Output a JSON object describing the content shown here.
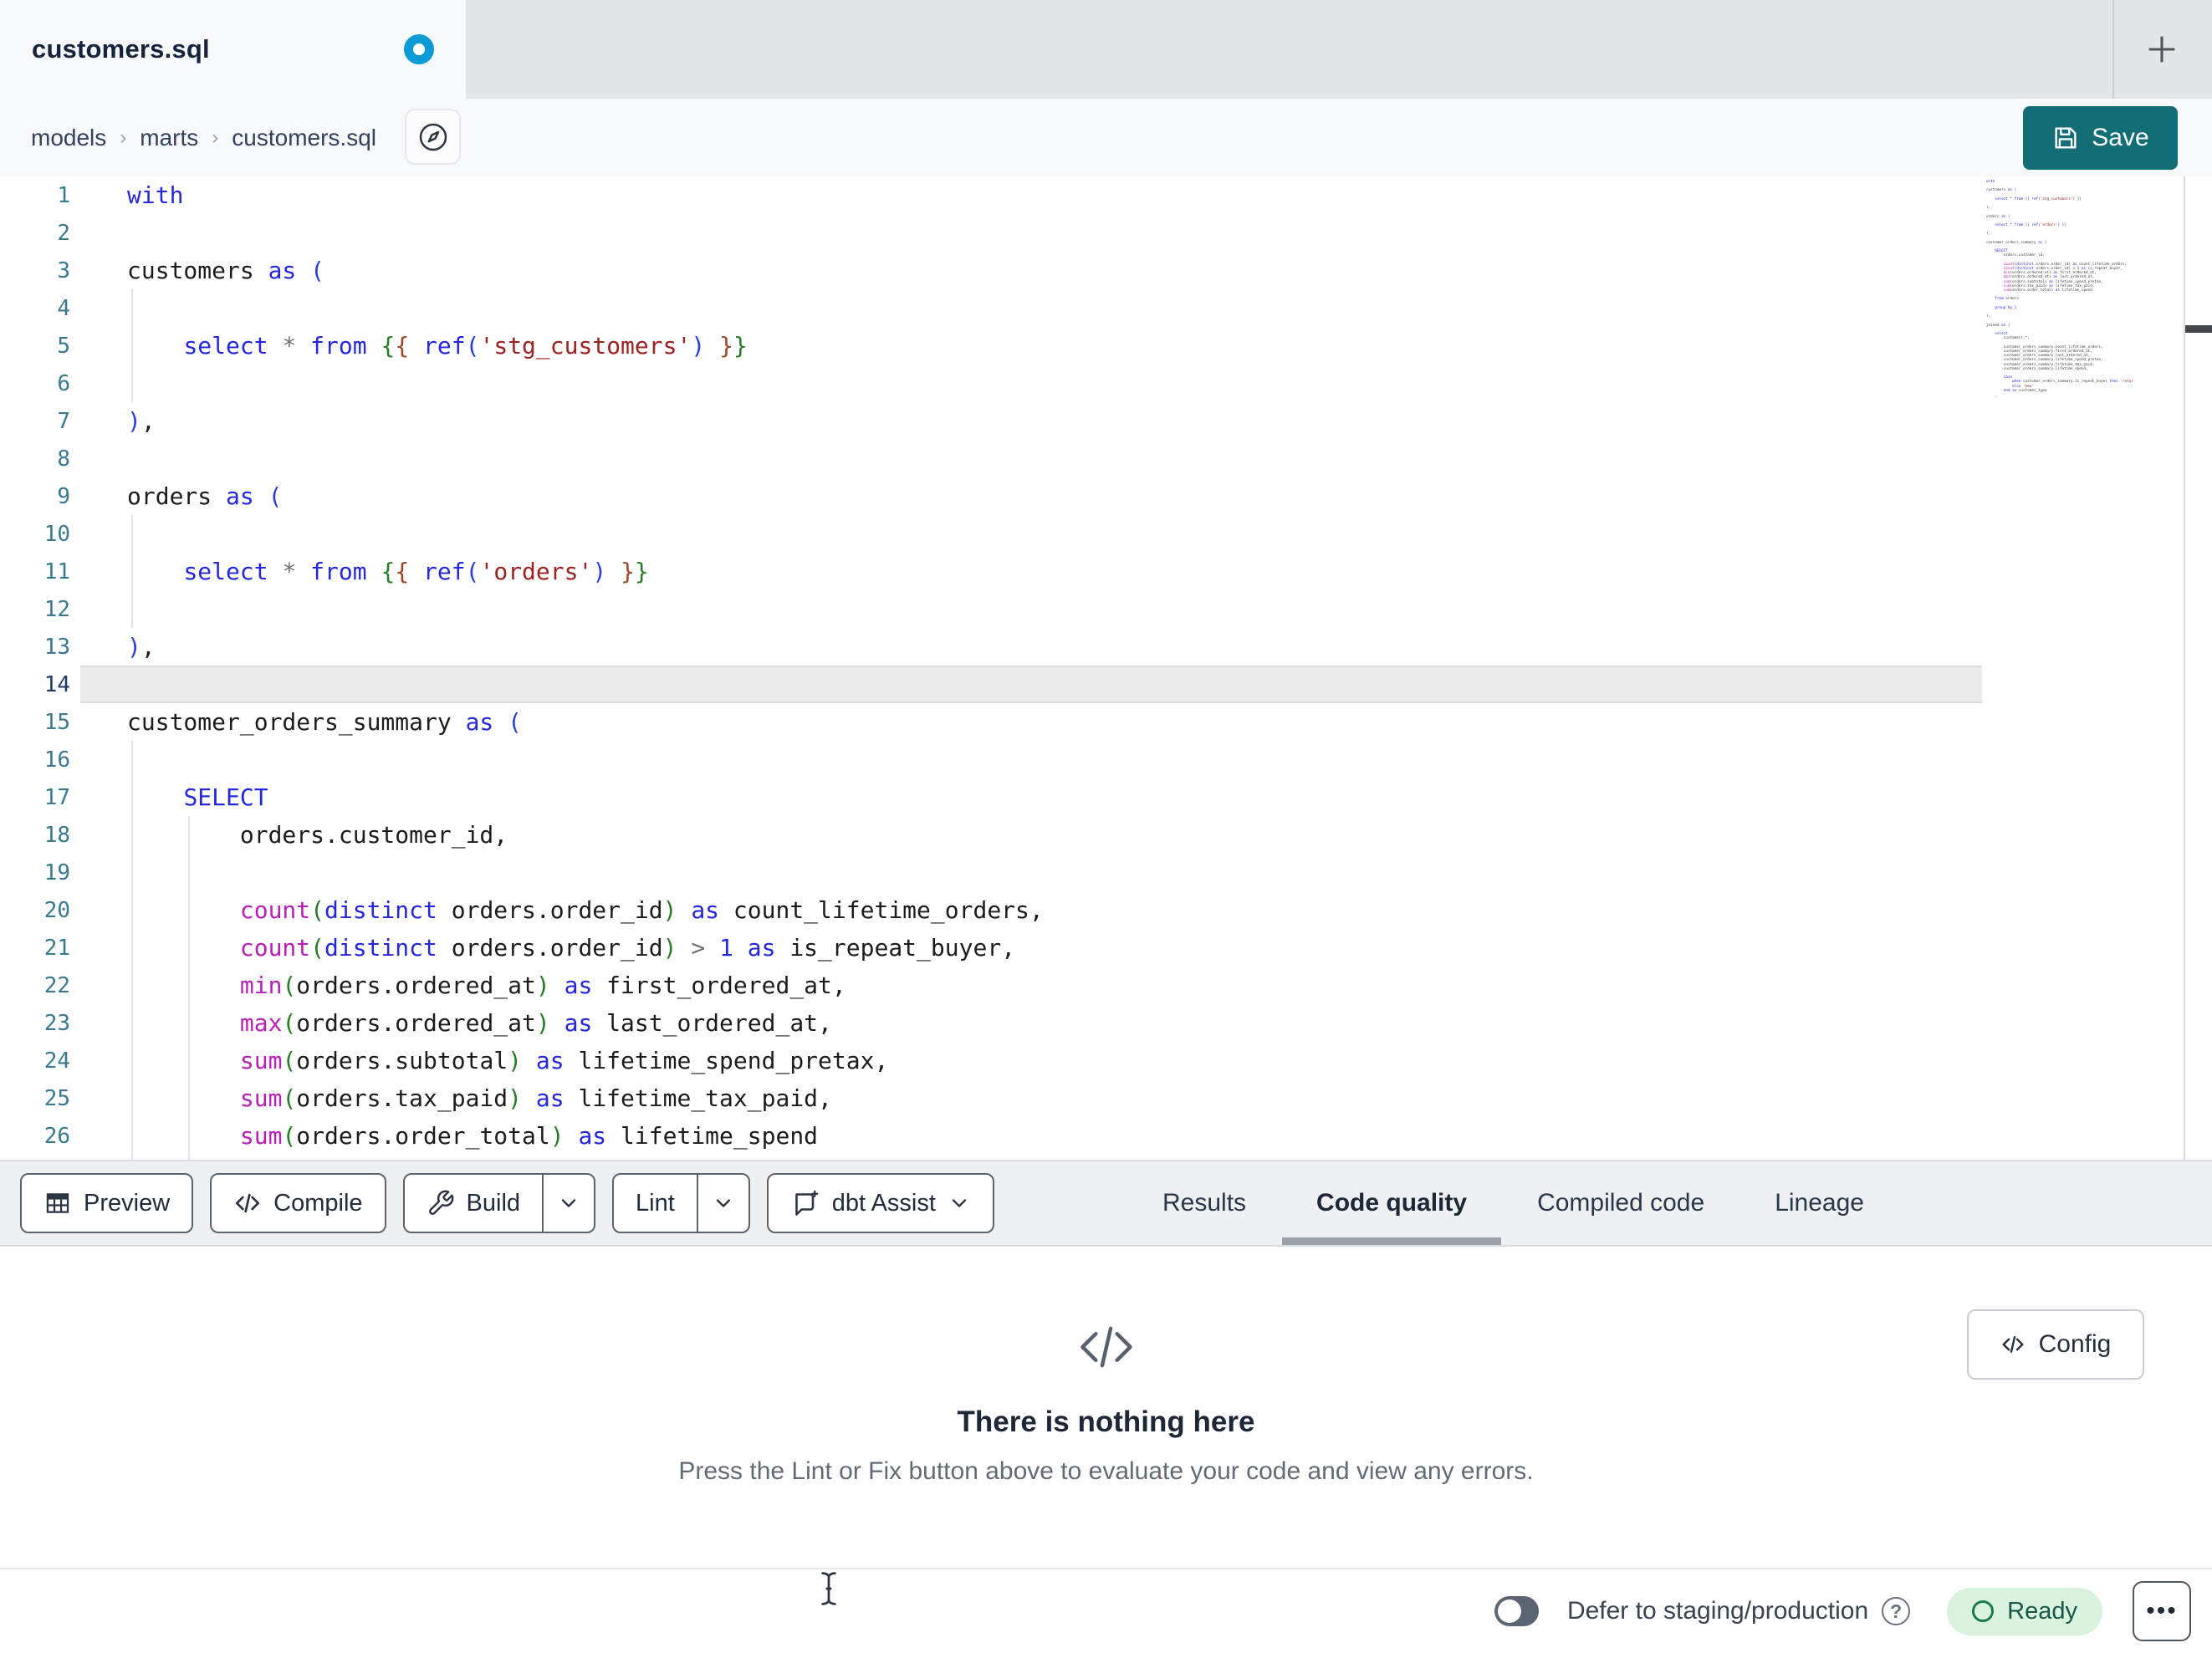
{
  "window": {
    "tab_title": "customers.sql",
    "unsaved_indicator": "unsaved-changes-dot",
    "new_tab_glyph": "+"
  },
  "breadcrumb": {
    "items": [
      "models",
      "marts",
      "customers.sql"
    ],
    "separator": "›"
  },
  "actions": {
    "save_label": "Save"
  },
  "editor": {
    "current_line": 14,
    "lines": [
      {
        "n": 1,
        "tokens": [
          {
            "t": "with",
            "c": "kw"
          }
        ]
      },
      {
        "n": 2,
        "tokens": []
      },
      {
        "n": 3,
        "tokens": [
          {
            "t": "customers ",
            "c": "pl"
          },
          {
            "t": "as",
            "c": "kw"
          },
          {
            "t": " ",
            "c": "pl"
          },
          {
            "t": "(",
            "c": "b3"
          }
        ]
      },
      {
        "n": 4,
        "tokens": []
      },
      {
        "n": 5,
        "tokens": [
          {
            "t": "    ",
            "c": "pl"
          },
          {
            "t": "select",
            "c": "kw"
          },
          {
            "t": " ",
            "c": "pl"
          },
          {
            "t": "*",
            "c": "op"
          },
          {
            "t": " ",
            "c": "pl"
          },
          {
            "t": "from",
            "c": "kw"
          },
          {
            "t": " ",
            "c": "pl"
          },
          {
            "t": "{",
            "c": "b1"
          },
          {
            "t": "{",
            "c": "b2"
          },
          {
            "t": " ",
            "c": "pl"
          },
          {
            "t": "ref",
            "c": "kw"
          },
          {
            "t": "(",
            "c": "b3"
          },
          {
            "t": "'stg_customers'",
            "c": "str"
          },
          {
            "t": ")",
            "c": "b3"
          },
          {
            "t": " ",
            "c": "pl"
          },
          {
            "t": "}",
            "c": "b2"
          },
          {
            "t": "}",
            "c": "b1"
          }
        ]
      },
      {
        "n": 6,
        "tokens": []
      },
      {
        "n": 7,
        "tokens": [
          {
            "t": ")",
            "c": "b3"
          },
          {
            "t": ",",
            "c": "pl"
          }
        ]
      },
      {
        "n": 8,
        "tokens": []
      },
      {
        "n": 9,
        "tokens": [
          {
            "t": "orders ",
            "c": "pl"
          },
          {
            "t": "as",
            "c": "kw"
          },
          {
            "t": " ",
            "c": "pl"
          },
          {
            "t": "(",
            "c": "b3"
          }
        ]
      },
      {
        "n": 10,
        "tokens": []
      },
      {
        "n": 11,
        "tokens": [
          {
            "t": "    ",
            "c": "pl"
          },
          {
            "t": "select",
            "c": "kw"
          },
          {
            "t": " ",
            "c": "pl"
          },
          {
            "t": "*",
            "c": "op"
          },
          {
            "t": " ",
            "c": "pl"
          },
          {
            "t": "from",
            "c": "kw"
          },
          {
            "t": " ",
            "c": "pl"
          },
          {
            "t": "{",
            "c": "b1"
          },
          {
            "t": "{",
            "c": "b2"
          },
          {
            "t": " ",
            "c": "pl"
          },
          {
            "t": "ref",
            "c": "kw"
          },
          {
            "t": "(",
            "c": "b3"
          },
          {
            "t": "'orders'",
            "c": "str"
          },
          {
            "t": ")",
            "c": "b3"
          },
          {
            "t": " ",
            "c": "pl"
          },
          {
            "t": "}",
            "c": "b2"
          },
          {
            "t": "}",
            "c": "b1"
          }
        ]
      },
      {
        "n": 12,
        "tokens": []
      },
      {
        "n": 13,
        "tokens": [
          {
            "t": ")",
            "c": "b3"
          },
          {
            "t": ",",
            "c": "pl"
          }
        ]
      },
      {
        "n": 14,
        "tokens": [],
        "current": true
      },
      {
        "n": 15,
        "tokens": [
          {
            "t": "customer_orders_summary ",
            "c": "pl"
          },
          {
            "t": "as",
            "c": "kw"
          },
          {
            "t": " ",
            "c": "pl"
          },
          {
            "t": "(",
            "c": "b3"
          }
        ]
      },
      {
        "n": 16,
        "tokens": []
      },
      {
        "n": 17,
        "tokens": [
          {
            "t": "    ",
            "c": "pl"
          },
          {
            "t": "SELECT",
            "c": "kw"
          }
        ]
      },
      {
        "n": 18,
        "tokens": [
          {
            "t": "        orders.customer_id,",
            "c": "pl"
          }
        ]
      },
      {
        "n": 19,
        "tokens": []
      },
      {
        "n": 20,
        "tokens": [
          {
            "t": "        ",
            "c": "pl"
          },
          {
            "t": "count",
            "c": "fn"
          },
          {
            "t": "(",
            "c": "b1"
          },
          {
            "t": "distinct",
            "c": "kw"
          },
          {
            "t": " orders.order_id",
            "c": "pl"
          },
          {
            "t": ")",
            "c": "b1"
          },
          {
            "t": " ",
            "c": "pl"
          },
          {
            "t": "as",
            "c": "kw"
          },
          {
            "t": " count_lifetime_orders,",
            "c": "pl"
          }
        ]
      },
      {
        "n": 21,
        "tokens": [
          {
            "t": "        ",
            "c": "pl"
          },
          {
            "t": "count",
            "c": "fn"
          },
          {
            "t": "(",
            "c": "b1"
          },
          {
            "t": "distinct",
            "c": "kw"
          },
          {
            "t": " orders.order_id",
            "c": "pl"
          },
          {
            "t": ")",
            "c": "b1"
          },
          {
            "t": " ",
            "c": "pl"
          },
          {
            "t": ">",
            "c": "op"
          },
          {
            "t": " ",
            "c": "pl"
          },
          {
            "t": "1",
            "c": "num"
          },
          {
            "t": " ",
            "c": "pl"
          },
          {
            "t": "as",
            "c": "kw"
          },
          {
            "t": " is_repeat_buyer,",
            "c": "pl"
          }
        ]
      },
      {
        "n": 22,
        "tokens": [
          {
            "t": "        ",
            "c": "pl"
          },
          {
            "t": "min",
            "c": "fn"
          },
          {
            "t": "(",
            "c": "b1"
          },
          {
            "t": "orders.ordered_at",
            "c": "pl"
          },
          {
            "t": ")",
            "c": "b1"
          },
          {
            "t": " ",
            "c": "pl"
          },
          {
            "t": "as",
            "c": "kw"
          },
          {
            "t": " first_ordered_at,",
            "c": "pl"
          }
        ]
      },
      {
        "n": 23,
        "tokens": [
          {
            "t": "        ",
            "c": "pl"
          },
          {
            "t": "max",
            "c": "fn"
          },
          {
            "t": "(",
            "c": "b1"
          },
          {
            "t": "orders.ordered_at",
            "c": "pl"
          },
          {
            "t": ")",
            "c": "b1"
          },
          {
            "t": " ",
            "c": "pl"
          },
          {
            "t": "as",
            "c": "kw"
          },
          {
            "t": " last_ordered_at,",
            "c": "pl"
          }
        ]
      },
      {
        "n": 24,
        "tokens": [
          {
            "t": "        ",
            "c": "pl"
          },
          {
            "t": "sum",
            "c": "fn"
          },
          {
            "t": "(",
            "c": "b1"
          },
          {
            "t": "orders.subtotal",
            "c": "pl"
          },
          {
            "t": ")",
            "c": "b1"
          },
          {
            "t": " ",
            "c": "pl"
          },
          {
            "t": "as",
            "c": "kw"
          },
          {
            "t": " lifetime_spend_pretax,",
            "c": "pl"
          }
        ]
      },
      {
        "n": 25,
        "tokens": [
          {
            "t": "        ",
            "c": "pl"
          },
          {
            "t": "sum",
            "c": "fn"
          },
          {
            "t": "(",
            "c": "b1"
          },
          {
            "t": "orders.tax_paid",
            "c": "pl"
          },
          {
            "t": ")",
            "c": "b1"
          },
          {
            "t": " ",
            "c": "pl"
          },
          {
            "t": "as",
            "c": "kw"
          },
          {
            "t": " lifetime_tax_paid,",
            "c": "pl"
          }
        ]
      },
      {
        "n": 26,
        "tokens": [
          {
            "t": "        ",
            "c": "pl"
          },
          {
            "t": "sum",
            "c": "fn"
          },
          {
            "t": "(",
            "c": "b1"
          },
          {
            "t": "orders.order_total",
            "c": "pl"
          },
          {
            "t": ")",
            "c": "b1"
          },
          {
            "t": " ",
            "c": "pl"
          },
          {
            "t": "as",
            "c": "kw"
          },
          {
            "t": " lifetime_spend",
            "c": "pl"
          }
        ]
      }
    ],
    "minimap_code": "with\n\ncustomers as (\n\n    select * from {{ ref('stg_customers') }}\n\n),\n\norders as (\n\n    select * from {{ ref('orders') }}\n\n),\n\ncustomer_orders_summary as (\n\n    SELECT\n        orders.customer_id,\n\n        count(distinct orders.order_id) as count_lifetime_orders,\n        count(distinct orders.order_id) > 1 as is_repeat_buyer,\n        min(orders.ordered_at) as first_ordered_at,\n        max(orders.ordered_at) as last_ordered_at,\n        sum(orders.subtotal) as lifetime_spend_pretax,\n        sum(orders.tax_paid) as lifetime_tax_paid,\n        sum(orders.order_total) as lifetime_spend\n\n    from orders\n\n    group by 1\n\n),\n\njoined as (\n\n    select\n        customers.*,\n\n        customer_orders_summary.count_lifetime_orders,\n        customer_orders_summary.first_ordered_at,\n        customer_orders_summary.last_ordered_at,\n        customer_orders_summary.lifetime_spend_pretax,\n        customer_orders_summary.lifetime_tax_paid,\n        customer_orders_summary.lifetime_spend,\n\n        case\n            when customer_orders_summary.is_repeat_buyer then 'returning'\n            else 'new'\n        end as customer_type\n\n    from customers\n\n    left join customer_orders_summary\n        on customers.customer_id = customer_orders_summary.customer_id\n\n)\n\nselect * from joined"
  },
  "toolbar": {
    "preview_label": "Preview",
    "compile_label": "Compile",
    "build_label": "Build",
    "lint_label": "Lint",
    "dbt_assist_label": "dbt Assist"
  },
  "result_tabs": [
    {
      "label": "Results",
      "active": false
    },
    {
      "label": "Code quality",
      "active": true
    },
    {
      "label": "Compiled code",
      "active": false
    },
    {
      "label": "Lineage",
      "active": false
    }
  ],
  "panel": {
    "empty_title": "There is nothing here",
    "empty_subtitle": "Press the Lint or Fix button above to evaluate your code and view any errors.",
    "config_label": "Config"
  },
  "statusbar": {
    "defer_label": "Defer to staging/production",
    "help_glyph": "?",
    "ready_label": "Ready",
    "more_glyph": "•••"
  },
  "colors": {
    "accent_teal": "#136d74",
    "unsaved_dot_blue": "#0d9bd7",
    "ready_bg": "#d9f3de",
    "ready_green": "#1b7a50",
    "syntax_keyword_blue": "#2427de",
    "syntax_function_magenta": "#b81fb8",
    "syntax_string_red": "#9c2121",
    "syntax_bracket_green": "#267d26",
    "syntax_bracket_maroon": "#9c4528",
    "syntax_operator_gray": "#6e7277",
    "line_number_teal": "#3a7a8e"
  }
}
